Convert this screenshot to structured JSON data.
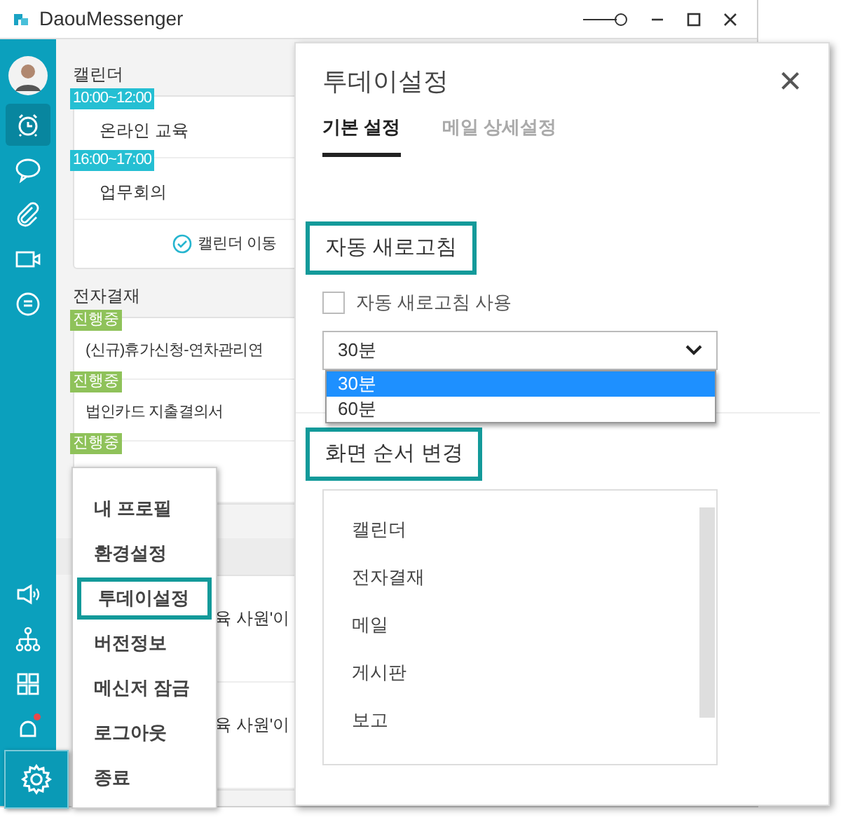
{
  "window": {
    "title": "DaouMessenger"
  },
  "sidebar": {
    "items": [
      {
        "kind": "alarm",
        "selected": true
      },
      {
        "kind": "chat",
        "selected": false
      },
      {
        "kind": "clip",
        "selected": false
      },
      {
        "kind": "video",
        "selected": false
      },
      {
        "kind": "chatlist",
        "selected": false
      }
    ],
    "bottom_items": [
      {
        "kind": "speaker",
        "selected": false,
        "badge": false
      },
      {
        "kind": "org",
        "selected": false,
        "badge": false
      },
      {
        "kind": "grid",
        "selected": false,
        "badge": false
      },
      {
        "kind": "bell",
        "selected": false,
        "badge": true
      },
      {
        "kind": "settings",
        "selected": true,
        "badge": false
      }
    ]
  },
  "calendar": {
    "title": "캘린더",
    "events": [
      {
        "time": "10:00~12:00",
        "title": "온라인 교육"
      },
      {
        "time": "16:00~17:00",
        "title": "업무회의"
      }
    ],
    "link": "캘린더 이동"
  },
  "approval": {
    "title": "전자결재",
    "items": [
      {
        "status": "진행중",
        "title": "(신규)휴가신청-연차관리연"
      },
      {
        "status": "진행중",
        "title": "법인카드 지출결의서"
      },
      {
        "status": "진행중"
      }
    ]
  },
  "notices": [
    "육 사원'이",
    "육 사원'이"
  ],
  "menu": {
    "items": [
      {
        "label": "내 프로필",
        "selected": false
      },
      {
        "label": "환경설정",
        "selected": false
      },
      {
        "label": "투데이설정",
        "selected": true
      },
      {
        "label": "버전정보",
        "selected": false
      },
      {
        "label": "메신저 잠금",
        "selected": false
      },
      {
        "label": "로그아웃",
        "selected": false
      },
      {
        "label": "종료",
        "selected": false
      }
    ]
  },
  "dialog": {
    "title": "투데이설정",
    "close": "×",
    "tabs": [
      {
        "label": "기본 설정",
        "selected": true
      },
      {
        "label": "메일 상세설정",
        "selected": false
      }
    ],
    "refresh": {
      "heading": "자동 새로고침",
      "highlighted": true,
      "checkbox": {
        "label": "자동 새로고침 사용",
        "checked": false
      },
      "select": {
        "value": "30분",
        "options": [
          {
            "label": "30분",
            "selected": true
          },
          {
            "label": "60분",
            "selected": false
          }
        ]
      }
    },
    "order": {
      "heading": "화면 순서 변경",
      "highlighted": true,
      "items": [
        "캘린더",
        "전자결재",
        "메일",
        "게시판",
        "보고"
      ]
    }
  }
}
